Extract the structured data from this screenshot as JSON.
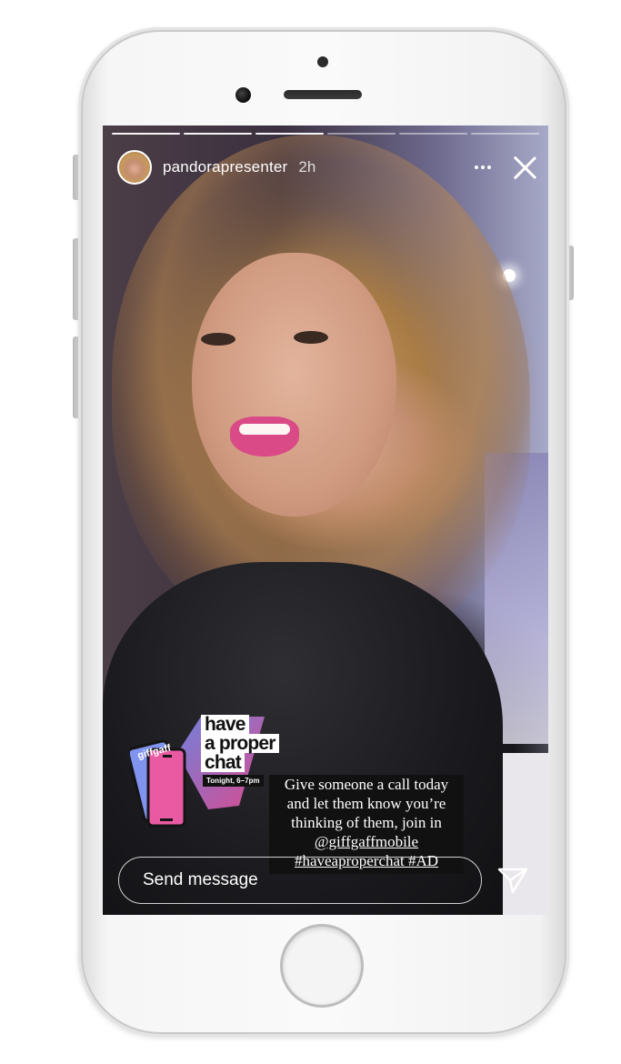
{
  "story": {
    "username": "pandorapresenter",
    "time_ago": "2h",
    "progress_segments": 6,
    "progress_done": 3
  },
  "sticker": {
    "brand": "giffgaff",
    "title_lines": [
      "have",
      "a proper",
      "chat"
    ],
    "tagline": "Tonight, 6–7pm"
  },
  "caption": {
    "lines": [
      "Give someone a call today",
      "and let them know you’re",
      "thinking of them, join in",
      "@giffgaffmobile",
      "#haveaproperchat #AD"
    ]
  },
  "composer": {
    "placeholder": "Send message"
  },
  "icons": {
    "more": "more-horizontal-icon",
    "close": "close-icon",
    "send": "send-paper-plane-icon"
  },
  "colors": {
    "sticker_gradient_start": "#7a8cf0",
    "sticker_gradient_end": "#ee4f9a"
  }
}
